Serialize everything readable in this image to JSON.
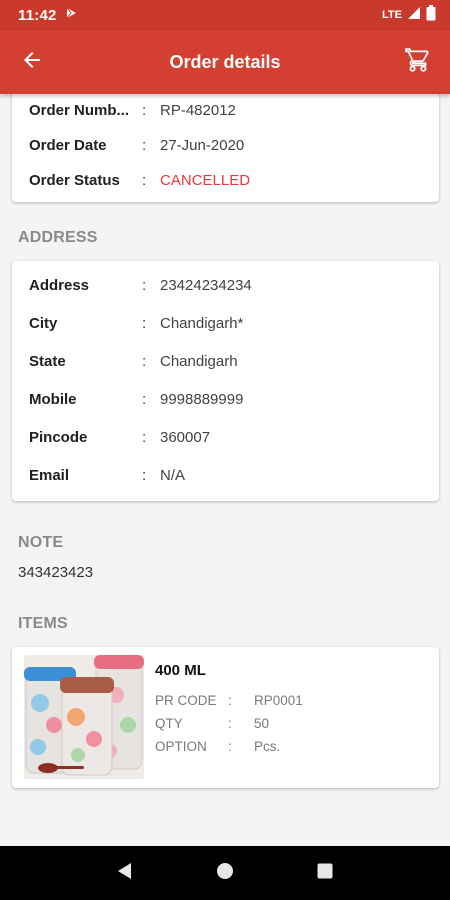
{
  "status_bar": {
    "time": "11:42",
    "network": "LTE"
  },
  "app_bar": {
    "title": "Order details"
  },
  "order": {
    "rows": [
      {
        "label": "Order Numb...",
        "value": "RP-482012"
      },
      {
        "label": "Order Date",
        "value": "27-Jun-2020"
      },
      {
        "label": "Order Status",
        "value": "CANCELLED"
      }
    ]
  },
  "address": {
    "section_title": "ADDRESS",
    "rows": [
      {
        "label": "Address",
        "value": "23424234234"
      },
      {
        "label": "City",
        "value": "Chandigarh*"
      },
      {
        "label": "State",
        "value": "Chandigarh"
      },
      {
        "label": "Mobile",
        "value": "9998889999"
      },
      {
        "label": "Pincode",
        "value": "360007"
      },
      {
        "label": "Email",
        "value": "N/A"
      }
    ]
  },
  "note": {
    "section_title": "NOTE",
    "text": "343423423"
  },
  "items": {
    "section_title": "ITEMS",
    "list": [
      {
        "name": "400 ML",
        "rows": [
          {
            "label": "PR CODE",
            "value": "RP0001"
          },
          {
            "label": "QTY",
            "value": "50"
          },
          {
            "label": "OPTION",
            "value": "Pcs."
          }
        ]
      }
    ]
  },
  "separator": ":",
  "colors": {
    "app_bar": "#d33f31",
    "status_bar": "#c9392c",
    "cancelled": "#e5383b",
    "section_title": "#8a8a8a"
  },
  "icons": {
    "back": "arrow-left-icon",
    "cart": "cart-icon",
    "play_store": "play-icon",
    "signal": "signal-icon",
    "battery": "battery-icon",
    "nav_back": "triangle-back-icon",
    "nav_home": "circle-home-icon",
    "nav_recents": "square-recents-icon"
  }
}
